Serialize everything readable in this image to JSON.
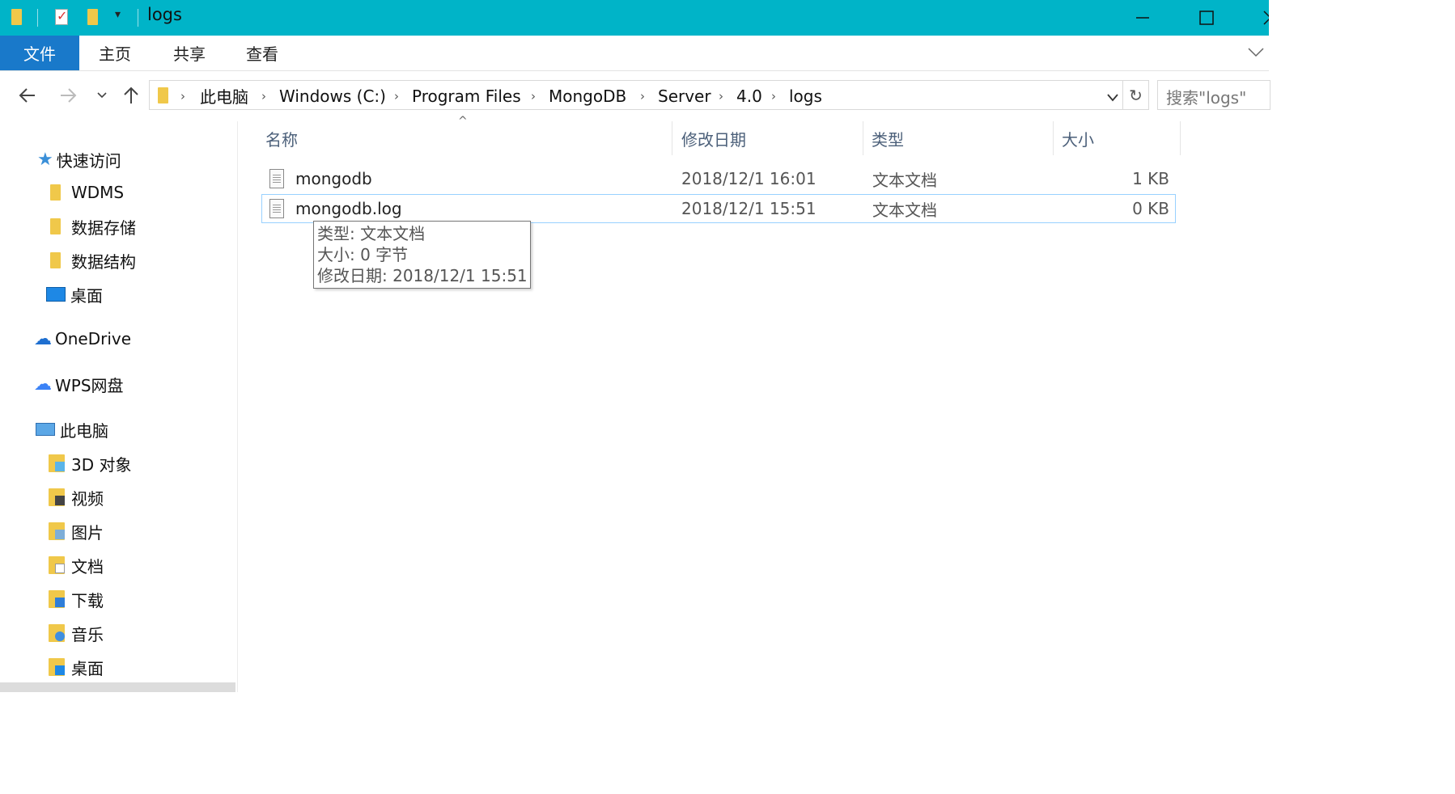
{
  "window": {
    "title": "logs",
    "colors": {
      "titlebar": "#00b4c8",
      "accent": "#1979ca",
      "selection_border": "#99d1ff"
    }
  },
  "ribbon": {
    "tabs": [
      "文件",
      "主页",
      "共享",
      "查看"
    ]
  },
  "address": {
    "breadcrumbs": [
      "此电脑",
      "Windows (C:)",
      "Program Files",
      "MongoDB",
      "Server",
      "4.0",
      "logs"
    ]
  },
  "search": {
    "placeholder": "搜索\"logs\""
  },
  "sidebar": {
    "quick_access": {
      "label": "快速访问",
      "items": [
        {
          "label": "WDMS",
          "icon": "folder-icon"
        },
        {
          "label": "数据存储",
          "icon": "folder-icon"
        },
        {
          "label": "数据结构",
          "icon": "folder-icon"
        },
        {
          "label": "桌面",
          "icon": "desktop-icon"
        }
      ]
    },
    "onedrive": {
      "label": "OneDrive"
    },
    "wps": {
      "label": "WPS网盘"
    },
    "this_pc": {
      "label": "此电脑",
      "items": [
        {
          "label": "3D 对象",
          "icon": "3d-objects-icon"
        },
        {
          "label": "视频",
          "icon": "videos-icon"
        },
        {
          "label": "图片",
          "icon": "pictures-icon"
        },
        {
          "label": "文档",
          "icon": "documents-icon"
        },
        {
          "label": "下载",
          "icon": "downloads-icon"
        },
        {
          "label": "音乐",
          "icon": "music-icon"
        },
        {
          "label": "桌面",
          "icon": "desktop-icon"
        }
      ]
    }
  },
  "file_list": {
    "columns": [
      "名称",
      "修改日期",
      "类型",
      "大小"
    ],
    "rows": [
      {
        "name": "mongodb",
        "modified": "2018/12/1 16:01",
        "type": "文本文档",
        "size": "1 KB",
        "selected": false
      },
      {
        "name": "mongodb.log",
        "modified": "2018/12/1 15:51",
        "type": "文本文档",
        "size": "0 KB",
        "selected": true
      }
    ]
  },
  "tooltip": {
    "lines": [
      "类型: 文本文档",
      "大小: 0 字节",
      "修改日期: 2018/12/1 15:51"
    ]
  }
}
